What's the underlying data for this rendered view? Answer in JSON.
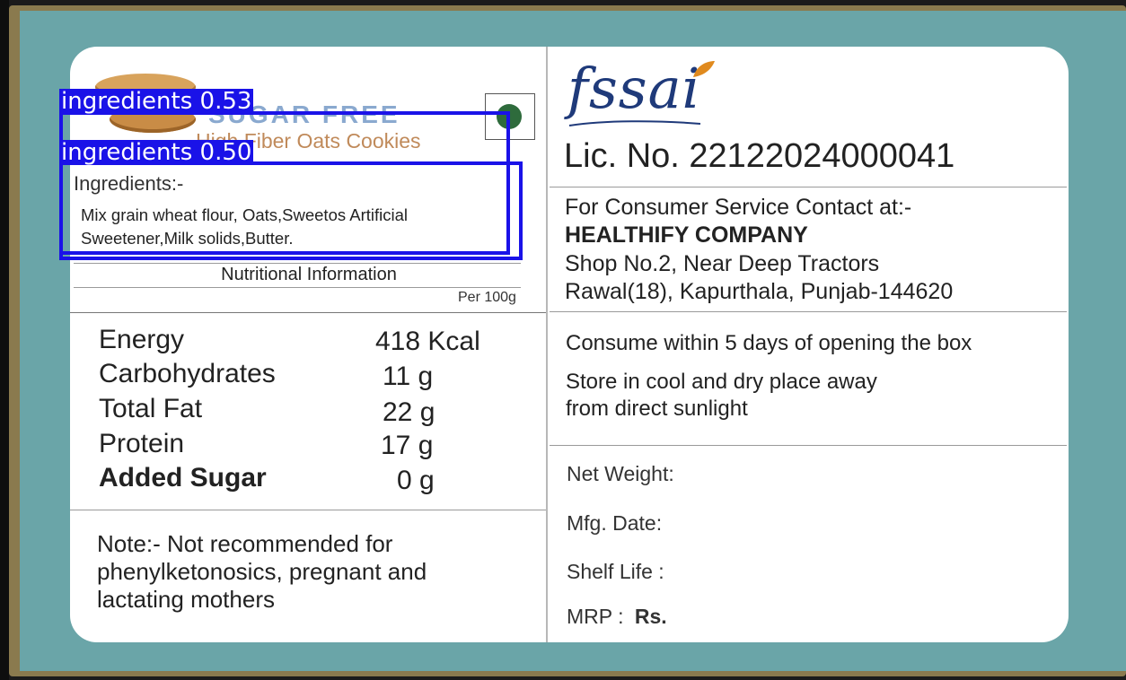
{
  "colors": {
    "detection": "#1a12e8",
    "teal": "#6aa5a8",
    "veg_dot": "#2e6b3c",
    "fssai_blue": "#1f3a7a",
    "fssai_orange": "#e08a1e"
  },
  "header": {
    "brand": "SUGAR FREE",
    "subtitle": "High Fiber Oats Cookies",
    "veg_icon": "veg-mark-icon",
    "cookie_icon": "cookies-image"
  },
  "ingredients": {
    "heading": "Ingredients:-",
    "text": "Mix grain wheat flour, Oats,Sweetos Artificial Sweetener,Milk solids,Butter."
  },
  "nutrition": {
    "title": "Nutritional Information",
    "per": "Per 100g",
    "rows": [
      {
        "name": "Energy",
        "value": "418 Kcal"
      },
      {
        "name": "Carbohydrates",
        "value": "11 g"
      },
      {
        "name": "Total Fat",
        "value": "22 g"
      },
      {
        "name": "Protein",
        "value": "17 g"
      },
      {
        "name": "Added Sugar",
        "value": "0 g"
      }
    ]
  },
  "note": {
    "line1": "Note:-   Not recommended for",
    "line2": "phenylketonosics, pregnant and",
    "line3": "lactating mothers"
  },
  "fssai": {
    "logo_text": "fssai",
    "license": "Lic. No. 22122024000041"
  },
  "contact": {
    "heading": "For Consumer Service Contact at:-",
    "company": "HEALTHIFY COMPANY",
    "address1": "Shop No.2, Near Deep Tractors",
    "address2": "Rawal(18), Kapurthala, Punjab-144620"
  },
  "storage": {
    "consume": "Consume within 5 days of opening the box",
    "store1": "Store in cool and dry place away",
    "store2": "from direct sunlight"
  },
  "details": {
    "net_weight": "Net Weight:",
    "mfg_date": "Mfg. Date:",
    "shelf_life": "Shelf Life  :",
    "mrp_label": "MRP :",
    "mrp_value": "Rs."
  },
  "detections": [
    {
      "label": "ingredients",
      "score": "0.53",
      "tag": "ingredients 0.53"
    },
    {
      "label": "ingredients",
      "score": "0.50",
      "tag": "ingredients 0.50"
    }
  ]
}
